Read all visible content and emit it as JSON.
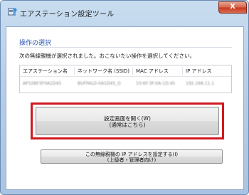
{
  "window": {
    "title": "エアステーション設定ツール",
    "close_glyph": "X"
  },
  "content": {
    "section_title": "操作の選択",
    "instruction": "次の無線親機が選択されました。おこないたい操作を選択してください。",
    "table": {
      "headers": [
        "エアステーション名",
        "ネットワーク名 (SSID)",
        "MAC アドレス",
        "IP アドレス"
      ],
      "rows": [
        [
          "AP10BF3F0A1D45",
          "BUFFALO-0A1D45_G",
          "10:6F:3F:0A:1D:45",
          "192.168.11.1"
        ]
      ]
    },
    "primary_button": {
      "line1": "設定画面を開く(W)",
      "line2": "(通常はこちら)"
    },
    "secondary_button": {
      "line1": "この無線親機の IP アドレスを設定する(I)",
      "line2": "(上級者・管理者向け)"
    }
  },
  "colors": {
    "highlight_border": "#d1191f",
    "section_title": "#2c57b4"
  }
}
